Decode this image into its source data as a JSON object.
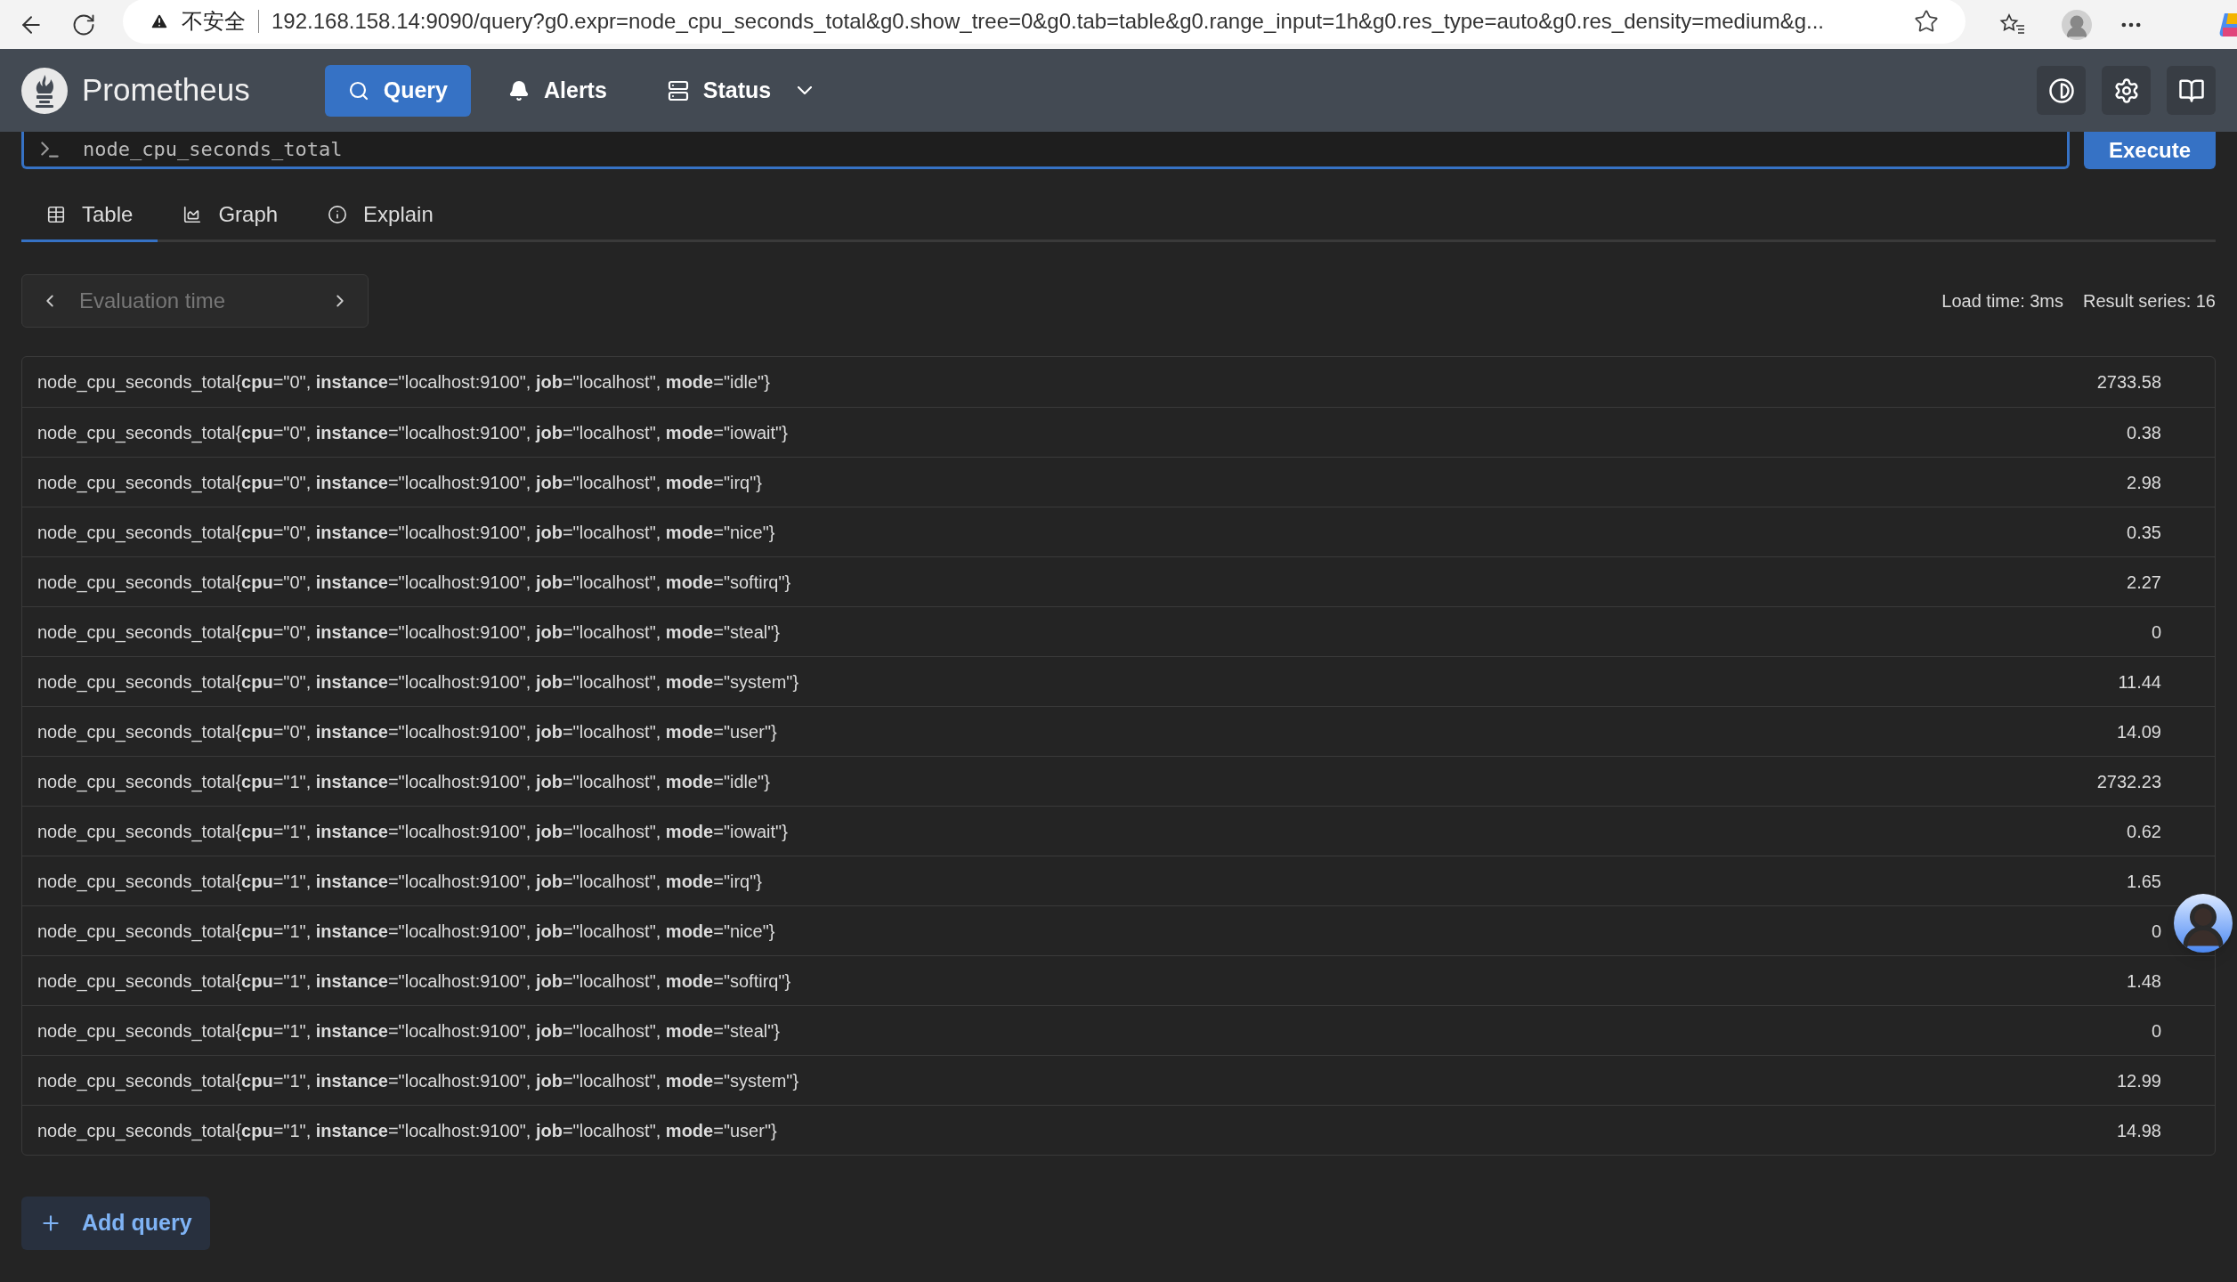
{
  "browser": {
    "security_label": "不安全",
    "url": "192.168.158.14:9090/query?g0.expr=node_cpu_seconds_total&g0.show_tree=0&g0.tab=table&g0.range_input=1h&g0.res_type=auto&g0.res_density=medium&g..."
  },
  "app": {
    "title": "Prometheus",
    "nav": [
      {
        "label": "Query",
        "selected": true,
        "has_menu": false
      },
      {
        "label": "Alerts",
        "selected": false,
        "has_menu": false
      },
      {
        "label": "Status",
        "selected": false,
        "has_menu": true
      }
    ]
  },
  "query": {
    "value": "node_cpu_seconds_total",
    "execute_button": "Execute"
  },
  "tabs": [
    {
      "label": "Table",
      "selected": true
    },
    {
      "label": "Graph",
      "selected": false
    },
    {
      "label": "Explain",
      "selected": false
    }
  ],
  "evaluation_time": {
    "placeholder": "Evaluation time"
  },
  "stats": [
    "Load time: 3ms",
    "Result series: 16"
  ],
  "rows": [
    {
      "series": "node_cpu_seconds_total{**cpu**=\"0\", **instance**=\"localhost:9100\", **job**=\"localhost\", **mode**=\"idle\"}",
      "value": "2733.58"
    },
    {
      "series": "node_cpu_seconds_total{**cpu**=\"0\", **instance**=\"localhost:9100\", **job**=\"localhost\", **mode**=\"iowait\"}",
      "value": "0.38"
    },
    {
      "series": "node_cpu_seconds_total{**cpu**=\"0\", **instance**=\"localhost:9100\", **job**=\"localhost\", **mode**=\"irq\"}",
      "value": "2.98"
    },
    {
      "series": "node_cpu_seconds_total{**cpu**=\"0\", **instance**=\"localhost:9100\", **job**=\"localhost\", **mode**=\"nice\"}",
      "value": "0.35"
    },
    {
      "series": "node_cpu_seconds_total{**cpu**=\"0\", **instance**=\"localhost:9100\", **job**=\"localhost\", **mode**=\"softirq\"}",
      "value": "2.27"
    },
    {
      "series": "node_cpu_seconds_total{**cpu**=\"0\", **instance**=\"localhost:9100\", **job**=\"localhost\", **mode**=\"steal\"}",
      "value": "0"
    },
    {
      "series": "node_cpu_seconds_total{**cpu**=\"0\", **instance**=\"localhost:9100\", **job**=\"localhost\", **mode**=\"system\"}",
      "value": "11.44"
    },
    {
      "series": "node_cpu_seconds_total{**cpu**=\"0\", **instance**=\"localhost:9100\", **job**=\"localhost\", **mode**=\"user\"}",
      "value": "14.09"
    },
    {
      "series": "node_cpu_seconds_total{**cpu**=\"1\", **instance**=\"localhost:9100\", **job**=\"localhost\", **mode**=\"idle\"}",
      "value": "2732.23"
    },
    {
      "series": "node_cpu_seconds_total{**cpu**=\"1\", **instance**=\"localhost:9100\", **job**=\"localhost\", **mode**=\"iowait\"}",
      "value": "0.62"
    },
    {
      "series": "node_cpu_seconds_total{**cpu**=\"1\", **instance**=\"localhost:9100\", **job**=\"localhost\", **mode**=\"irq\"}",
      "value": "1.65"
    },
    {
      "series": "node_cpu_seconds_total{**cpu**=\"1\", **instance**=\"localhost:9100\", **job**=\"localhost\", **mode**=\"nice\"}",
      "value": "0"
    },
    {
      "series": "node_cpu_seconds_total{**cpu**=\"1\", **instance**=\"localhost:9100\", **job**=\"localhost\", **mode**=\"softirq\"}",
      "value": "1.48"
    },
    {
      "series": "node_cpu_seconds_total{**cpu**=\"1\", **instance**=\"localhost:9100\", **job**=\"localhost\", **mode**=\"steal\"}",
      "value": "0"
    },
    {
      "series": "node_cpu_seconds_total{**cpu**=\"1\", **instance**=\"localhost:9100\", **job**=\"localhost\", **mode**=\"system\"}",
      "value": "12.99"
    },
    {
      "series": "node_cpu_seconds_total{**cpu**=\"1\", **instance**=\"localhost:9100\", **job**=\"localhost\", **mode**=\"user\"}",
      "value": "14.98"
    }
  ],
  "add_query_button": "Add query"
}
